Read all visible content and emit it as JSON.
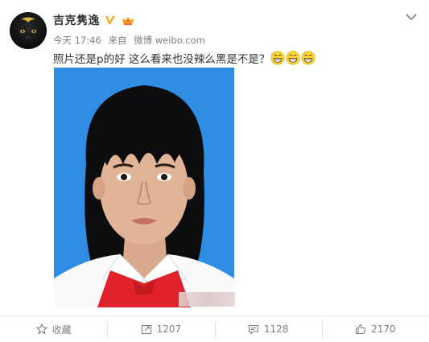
{
  "author": {
    "name": "吉克隽逸"
  },
  "meta": {
    "time": "今天 17:46",
    "source_prefix": "来自",
    "source": "微博 weibo.com"
  },
  "post": {
    "text": "照片还是p的好 这么看来也没辣么黑是不是？"
  },
  "actions": {
    "favorite": "收藏",
    "repost": "1207",
    "comment": "1128",
    "like": "2170"
  },
  "icons": [
    "moon-avatar",
    "verified-icon",
    "level-icon",
    "chevron-down-icon",
    "grin-emoji-icon",
    "star-icon",
    "share-icon",
    "comment-icon",
    "thumbs-up-icon"
  ],
  "colors": {
    "photo_bg": "#2f8ee3",
    "verified": "#f5a623",
    "text": "#333333",
    "meta": "#808080"
  }
}
